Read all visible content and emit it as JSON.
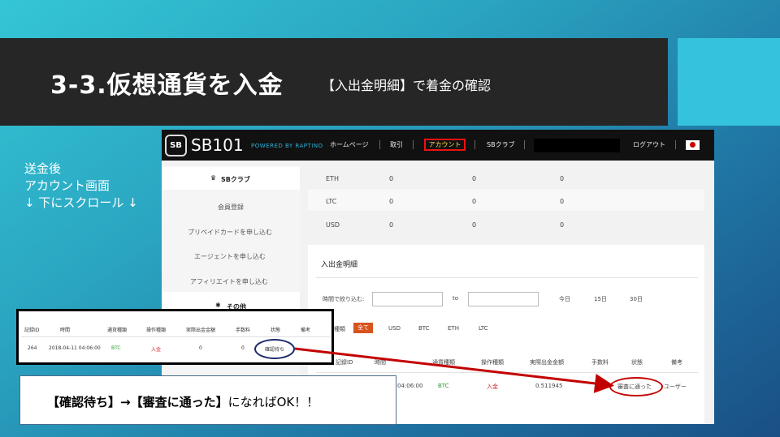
{
  "slide": {
    "title_main": "3-3.仮想通貨を入金",
    "title_sub": "【入出金明細】で着金の確認",
    "side_note": [
      "送金後",
      "アカウント画面",
      "↓ 下にスクロール ↓"
    ],
    "callout_bold1": "【確認待ち】→【審査に通った】",
    "callout_rest": "になればOK！！"
  },
  "site": {
    "logo_badge": "SB",
    "logo_text": "SB101",
    "logo_tag": "POWERED BY RAPTINO",
    "nav": [
      "ホームページ",
      "取引",
      "アカウント",
      "SBクラブ",
      "ログアウト"
    ],
    "sidebar_header": "SBクラブ",
    "sidebar_items": [
      "会員登録",
      "プリペイドカードを申し込む",
      "エージェントを申し込む",
      "アフィリエイトを申し込む"
    ],
    "sidebar_other": "その他",
    "balances": [
      {
        "currency": "ETH",
        "v1": "0",
        "v2": "0",
        "v3": "0"
      },
      {
        "currency": "LTC",
        "v1": "0",
        "v2": "0",
        "v3": "0"
      },
      {
        "currency": "USD",
        "v1": "0",
        "v2": "0",
        "v3": "0"
      }
    ],
    "history": {
      "title": "入出金明細",
      "time_filter_label": "時間で絞り込む:",
      "to": "to",
      "quick": [
        "今日",
        "15日",
        "30日"
      ],
      "type_label": "種類",
      "type_filters": [
        "全て",
        "USD",
        "BTC",
        "ETH",
        "LTC"
      ],
      "headers": [
        "記録ID",
        "時間",
        "通貨種類",
        "操作種類",
        "実際出金金額",
        "手数料",
        "状態",
        "備考"
      ],
      "row": {
        "id": "",
        "time": "04:06:00",
        "currency": "BTC",
        "op": "入金",
        "amount": "0.511945",
        "fee": "",
        "status": "審査に通った",
        "note": "ユーザー"
      }
    }
  },
  "inset": {
    "headers": [
      "記録ID",
      "時間",
      "通貨種類",
      "操作種類",
      "実際出金金額",
      "手数料",
      "状態",
      "備考"
    ],
    "row": {
      "id": "264",
      "time": "2018-04-11 04:06:00",
      "currency": "BTC",
      "op": "入金",
      "amount": "0",
      "fee": "0",
      "status": "確認待ち",
      "note": ""
    }
  },
  "colors": {
    "accent_red": "#c30000",
    "nav_highlight": "#ffd84a",
    "currency_green": "#2e9a2e",
    "op_red": "#d9222a"
  }
}
